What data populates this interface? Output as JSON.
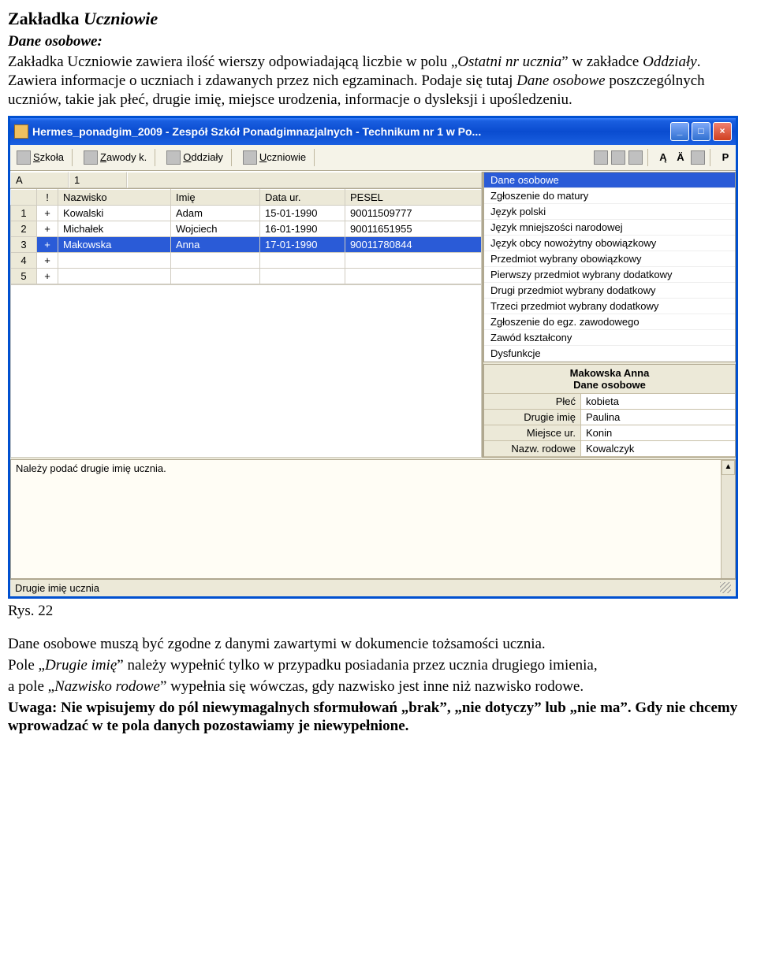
{
  "doc": {
    "title_prefix": "Zakładka ",
    "title_em": "Uczniowie",
    "subheading": "Dane osobowe:",
    "p1_a": "Zakładka Uczniowie zawiera ilość wierszy odpowiadającą liczbie w polu „",
    "p1_i1": "Ostatni nr ucznia",
    "p1_b": "” w zakładce ",
    "p1_i2": "Oddziały",
    "p1_c": ". Zawiera informacje o uczniach i zdawanych przez nich egzaminach. Podaje się tutaj ",
    "p1_i3": "Dane osobowe",
    "p1_d": " poszczególnych uczniów, takie jak płeć, drugie imię, miejsce urodzenia, informacje o dysleksji i upośledzeniu.",
    "caption": "Rys. 22",
    "p2": "Dane osobowe muszą być zgodne z danymi zawartymi w dokumencie tożsamości ucznia.",
    "p3_a": "Pole „",
    "p3_i1": "Drugie imię",
    "p3_b": "” należy wypełnić tylko w przypadku posiadania przez ucznia drugiego imienia,",
    "p4_a": "a pole „",
    "p4_i1": "Nazwisko rodowe",
    "p4_b": "” wypełnia się wówczas, gdy nazwisko jest inne niż nazwisko rodowe.",
    "p5": "Uwaga: Nie wpisujemy do pól niewymagalnych sformułowań „brak”, „nie dotyczy” lub „nie ma”. Gdy nie chcemy wprowadzać w te pola danych pozostawiamy je niewypełnione."
  },
  "window": {
    "title": "Hermes_ponadgim_2009 - Zespół Szkół Ponadgimnazjalnych - Technikum nr 1 w Po...",
    "min": "_",
    "max": "□",
    "close": "×"
  },
  "toolbar": {
    "items": [
      {
        "label": "Szkoła",
        "name": "tab-szkola"
      },
      {
        "label": "Zawody k.",
        "name": "tab-zawody"
      },
      {
        "label": "Oddziały",
        "name": "tab-oddzialy"
      },
      {
        "label": "Uczniowie",
        "name": "tab-uczniowie"
      }
    ],
    "rightLetters": [
      "Ą",
      "Ä"
    ],
    "pLabel": "P"
  },
  "leftTop": {
    "col1": "A",
    "col2": "1"
  },
  "students": {
    "headers": {
      "idx": "",
      "flag": "!",
      "nazwisko": "Nazwisko",
      "imie": "Imię",
      "data": "Data ur.",
      "pesel": "PESEL"
    },
    "rows": [
      {
        "idx": "1",
        "flag": "+",
        "nazwisko": "Kowalski",
        "imie": "Adam",
        "data": "15-01-1990",
        "pesel": "90011509777",
        "selected": false
      },
      {
        "idx": "2",
        "flag": "+",
        "nazwisko": "Michałek",
        "imie": "Wojciech",
        "data": "16-01-1990",
        "pesel": "90011651955",
        "selected": false
      },
      {
        "idx": "3",
        "flag": "+",
        "nazwisko": "Makowska",
        "imie": "Anna",
        "data": "17-01-1990",
        "pesel": "90011780844",
        "selected": true
      },
      {
        "idx": "4",
        "flag": "+",
        "nazwisko": "",
        "imie": "",
        "data": "",
        "pesel": "",
        "selected": false
      },
      {
        "idx": "5",
        "flag": "+",
        "nazwisko": "",
        "imie": "",
        "data": "",
        "pesel": "",
        "selected": false
      }
    ]
  },
  "sideList": [
    {
      "label": "Dane osobowe",
      "selected": true
    },
    {
      "label": "Zgłoszenie do matury"
    },
    {
      "label": "Język polski"
    },
    {
      "label": "Język mniejszości narodowej"
    },
    {
      "label": "Język obcy nowożytny obowiązkowy"
    },
    {
      "label": "Przedmiot wybrany obowiązkowy"
    },
    {
      "label": "Pierwszy przedmiot wybrany dodatkowy"
    },
    {
      "label": "Drugi przedmiot wybrany dodatkowy"
    },
    {
      "label": "Trzeci przedmiot wybrany dodatkowy"
    },
    {
      "label": "Zgłoszenie do egz. zawodowego"
    },
    {
      "label": "Zawód kształcony"
    },
    {
      "label": "Dysfunkcje"
    }
  ],
  "detail": {
    "title1": "Makowska Anna",
    "title2": "Dane osobowe",
    "rows": [
      {
        "label": "Płeć",
        "value": "kobieta"
      },
      {
        "label": "Drugie imię",
        "value": "Paulina"
      },
      {
        "label": "Miejsce ur.",
        "value": "Konin"
      },
      {
        "label": "Nazw. rodowe",
        "value": "Kowalczyk"
      }
    ]
  },
  "note": "Należy podać drugie imię ucznia.",
  "status": "Drugie imię ucznia"
}
